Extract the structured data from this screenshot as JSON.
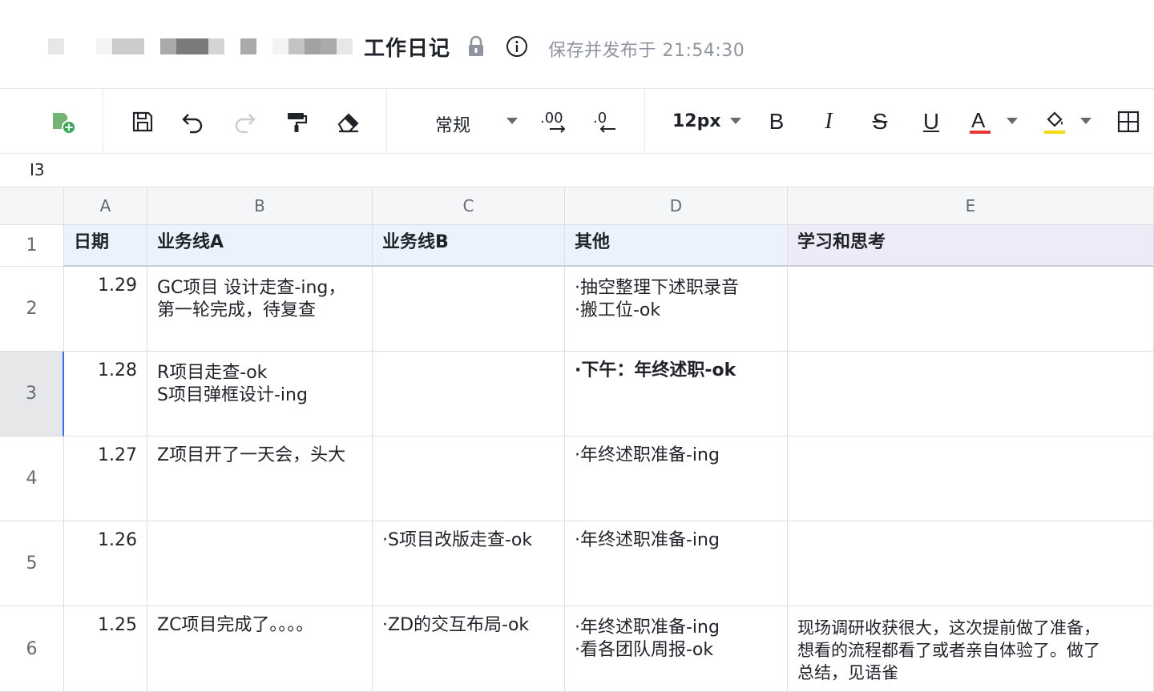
{
  "title_bar": {
    "doc_title": "工作日记",
    "save_status": "保存并发布于 21:54:30"
  },
  "toolbar": {
    "format_label": "常规",
    "decimal_increase_label": ".00",
    "decimal_decrease_label": ".0",
    "font_size_label": "12px",
    "font_color": "#e53935",
    "fill_color": "#f5d90a"
  },
  "cell_ref": "I3",
  "columns": [
    "A",
    "B",
    "C",
    "D",
    "E"
  ],
  "rows": [
    {
      "num": "1",
      "A": "日期",
      "B": "业务线A",
      "C": "业务线B",
      "D": "其他",
      "E": "学习和思考"
    },
    {
      "num": "2",
      "A": "1.29",
      "B": "GC项目 设计走查-ing，\n第一轮完成，待复查",
      "C": "",
      "D": "·抽空整理下述职录音\n·搬工位-ok",
      "E": ""
    },
    {
      "num": "3",
      "A": "1.28",
      "B": "R项目走查-ok\nS项目弹框设计-ing",
      "C": "",
      "D": "·下午：年终述职-ok",
      "E": ""
    },
    {
      "num": "4",
      "A": "1.27",
      "B": "Z项目开了一天会，头大",
      "C": "",
      "D": "·年终述职准备-ing",
      "E": ""
    },
    {
      "num": "5",
      "A": "1.26",
      "B": "",
      "C": "·S项目改版走查-ok",
      "D": "·年终述职准备-ing",
      "E": ""
    },
    {
      "num": "6",
      "A": "1.25",
      "B": "ZC项目完成了。。。。",
      "C": "·ZD的交互布局-ok",
      "D": "·年终述职准备-ing\n·看各团队周报-ok",
      "E": "现场调研收获很大，这次提前做了准备，\n想看的流程都看了或者亲自体验了。做了\n总结，见语雀"
    }
  ]
}
